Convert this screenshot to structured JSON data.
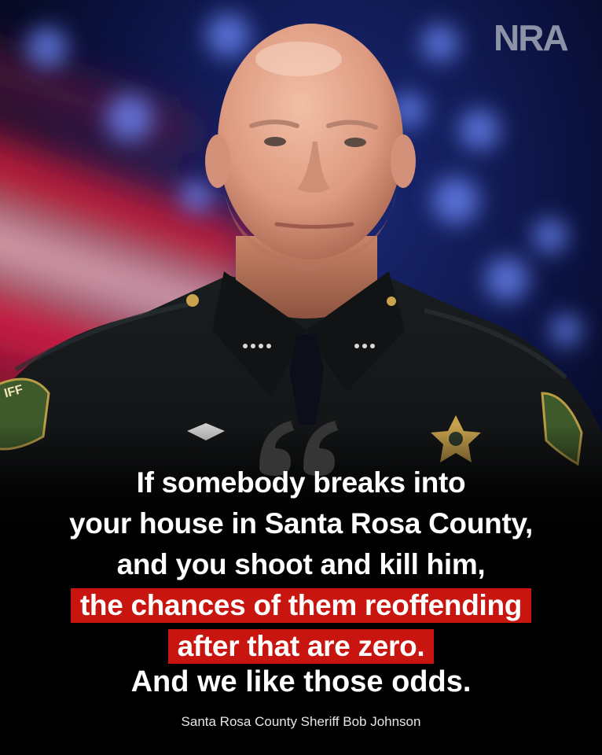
{
  "brand": {
    "logo_text": "NRA",
    "logo_color": "#8c93a6"
  },
  "colors": {
    "highlight": "#c8150f",
    "text": "#ffffff",
    "background": "#000000"
  },
  "quote": {
    "line1": "If somebody breaks into",
    "line2": "your house in Santa Rosa County,",
    "line3": "and you shoot and kill him,",
    "highlight1": "the chances of them reoffending",
    "highlight2": "after that are zero."
  },
  "tagline": "And we like those odds.",
  "attribution": "Santa Rosa County Sheriff Bob Johnson",
  "uniform": {
    "patch_text": "IFF"
  }
}
